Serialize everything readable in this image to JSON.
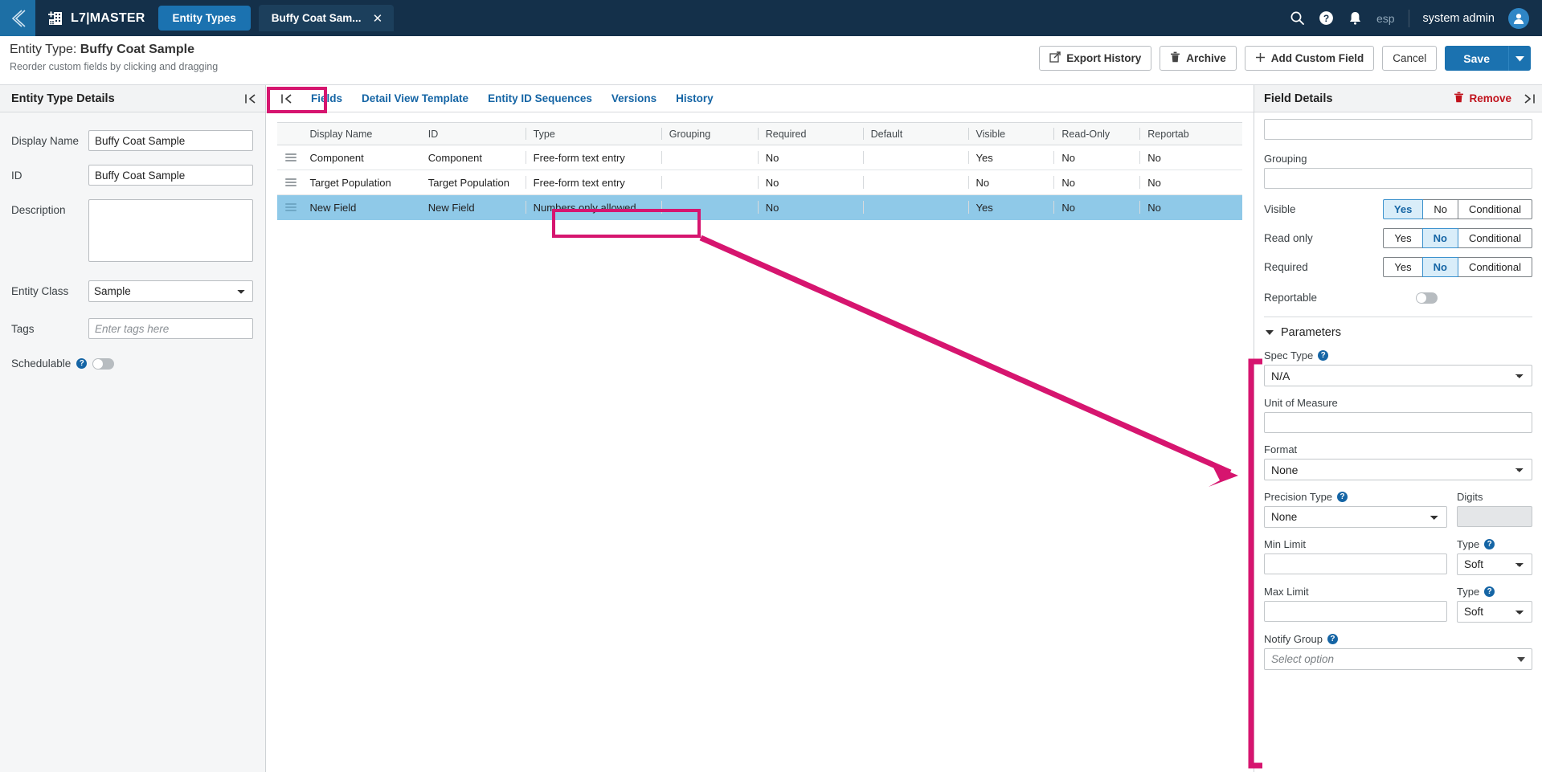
{
  "topbar": {
    "back_icon": "chevron-left-icon",
    "app_icon": "building-add-icon",
    "app_title": "L7|MASTER",
    "nav_pill": "Entity Types",
    "open_tab": "Buffy Coat Sam...",
    "close_icon": "close-icon",
    "search_icon": "search-icon",
    "help_icon": "question-circle-icon",
    "notification_icon": "bell-icon",
    "language": "esp",
    "user": "system admin",
    "avatar_icon": "user-avatar-icon"
  },
  "subheader": {
    "title_prefix": "Entity Type: ",
    "title_value": "Buffy Coat Sample",
    "subtitle": "Reorder custom fields by clicking and dragging",
    "buttons": {
      "export_history": "Export History",
      "archive": "Archive",
      "add_custom_field": "Add Custom Field",
      "cancel": "Cancel",
      "save": "Save"
    },
    "icons": {
      "export": "external-link-icon",
      "archive": "trash-icon",
      "add": "plus-icon",
      "save_caret": "chevron-down-icon"
    }
  },
  "left_panel": {
    "heading": "Entity Type Details",
    "collapse_icon": "collapse-left-icon",
    "fields": {
      "display_name_label": "Display Name",
      "display_name_value": "Buffy Coat Sample",
      "id_label": "ID",
      "id_value": "Buffy Coat Sample",
      "description_label": "Description",
      "description_value": "",
      "entity_class_label": "Entity Class",
      "entity_class_value": "Sample",
      "tags_label": "Tags",
      "tags_placeholder": "Enter tags here",
      "tags_value": "",
      "schedulable_label": "Schedulable",
      "schedulable_on": false
    }
  },
  "main": {
    "collapse_icon": "collapse-left-icon",
    "tabs": [
      {
        "label": "Fields",
        "active": true
      },
      {
        "label": "Detail View Template",
        "active": false
      },
      {
        "label": "Entity ID Sequences",
        "active": false
      },
      {
        "label": "Versions",
        "active": false
      },
      {
        "label": "History",
        "active": false
      }
    ],
    "table": {
      "columns": [
        "Display Name",
        "ID",
        "Type",
        "Grouping",
        "Required",
        "Default",
        "Visible",
        "Read-Only",
        "Reportab"
      ],
      "rows": [
        {
          "display_name": "Component",
          "id": "Component",
          "type": "Free-form text entry",
          "grouping": "",
          "required": "No",
          "default": "",
          "visible": "Yes",
          "read_only": "No",
          "reportable": "No",
          "selected": false
        },
        {
          "display_name": "Target Population",
          "id": "Target Population",
          "type": "Free-form text entry",
          "grouping": "",
          "required": "No",
          "default": "",
          "visible": "No",
          "read_only": "No",
          "reportable": "No",
          "selected": false
        },
        {
          "display_name": "New Field",
          "id": "New Field",
          "type": "Numbers only allowed",
          "grouping": "",
          "required": "No",
          "default": "",
          "visible": "Yes",
          "read_only": "No",
          "reportable": "No",
          "selected": true
        }
      ]
    }
  },
  "right_panel": {
    "heading": "Field Details",
    "remove_label": "Remove",
    "remove_icon": "trash-icon",
    "expand_icon": "collapse-right-icon",
    "top_input_value": "",
    "grouping_label": "Grouping",
    "grouping_value": "",
    "segments": [
      {
        "label": "Visible",
        "options": [
          "Yes",
          "No",
          "Conditional"
        ],
        "selected": "Yes"
      },
      {
        "label": "Read only",
        "options": [
          "Yes",
          "No",
          "Conditional"
        ],
        "selected": "No"
      },
      {
        "label": "Required",
        "options": [
          "Yes",
          "No",
          "Conditional"
        ],
        "selected": "No"
      }
    ],
    "reportable_label": "Reportable",
    "reportable_on": false,
    "parameters": {
      "heading": "Parameters",
      "spec_type_label": "Spec Type",
      "spec_type_value": "N/A",
      "unit_of_measure_label": "Unit of Measure",
      "unit_of_measure_value": "",
      "format_label": "Format",
      "format_value": "None",
      "precision_type_label": "Precision Type",
      "precision_type_value": "None",
      "digits_label": "Digits",
      "digits_value": "",
      "min_limit_label": "Min Limit",
      "min_limit_value": "",
      "min_type_label": "Type",
      "min_type_value": "Soft",
      "max_limit_label": "Max Limit",
      "max_limit_value": "",
      "max_type_label": "Type",
      "max_type_value": "Soft",
      "notify_group_label": "Notify Group",
      "notify_group_placeholder": "Select option"
    }
  },
  "annotations": {
    "accent_color": "#d6156f",
    "highlight_type_cell": true,
    "highlight_fields_tab": true,
    "arrow_from_cell_to_parameters": true,
    "bracket_parameters_section": true
  }
}
